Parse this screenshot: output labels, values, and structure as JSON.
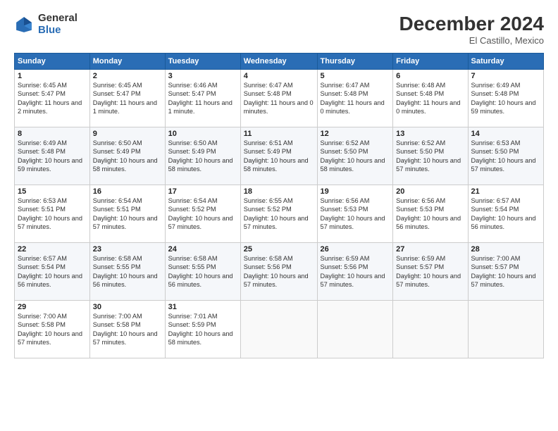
{
  "logo": {
    "general": "General",
    "blue": "Blue"
  },
  "title": "December 2024",
  "location": "El Castillo, Mexico",
  "weekdays": [
    "Sunday",
    "Monday",
    "Tuesday",
    "Wednesday",
    "Thursday",
    "Friday",
    "Saturday"
  ],
  "weeks": [
    [
      {
        "day": "1",
        "sunrise": "6:45 AM",
        "sunset": "5:47 PM",
        "daylight": "11 hours and 2 minutes."
      },
      {
        "day": "2",
        "sunrise": "6:45 AM",
        "sunset": "5:47 PM",
        "daylight": "11 hours and 1 minute."
      },
      {
        "day": "3",
        "sunrise": "6:46 AM",
        "sunset": "5:47 PM",
        "daylight": "11 hours and 1 minute."
      },
      {
        "day": "4",
        "sunrise": "6:47 AM",
        "sunset": "5:48 PM",
        "daylight": "11 hours and 0 minutes."
      },
      {
        "day": "5",
        "sunrise": "6:47 AM",
        "sunset": "5:48 PM",
        "daylight": "11 hours and 0 minutes."
      },
      {
        "day": "6",
        "sunrise": "6:48 AM",
        "sunset": "5:48 PM",
        "daylight": "11 hours and 0 minutes."
      },
      {
        "day": "7",
        "sunrise": "6:49 AM",
        "sunset": "5:48 PM",
        "daylight": "10 hours and 59 minutes."
      }
    ],
    [
      {
        "day": "8",
        "sunrise": "6:49 AM",
        "sunset": "5:48 PM",
        "daylight": "10 hours and 59 minutes."
      },
      {
        "day": "9",
        "sunrise": "6:50 AM",
        "sunset": "5:49 PM",
        "daylight": "10 hours and 58 minutes."
      },
      {
        "day": "10",
        "sunrise": "6:50 AM",
        "sunset": "5:49 PM",
        "daylight": "10 hours and 58 minutes."
      },
      {
        "day": "11",
        "sunrise": "6:51 AM",
        "sunset": "5:49 PM",
        "daylight": "10 hours and 58 minutes."
      },
      {
        "day": "12",
        "sunrise": "6:52 AM",
        "sunset": "5:50 PM",
        "daylight": "10 hours and 58 minutes."
      },
      {
        "day": "13",
        "sunrise": "6:52 AM",
        "sunset": "5:50 PM",
        "daylight": "10 hours and 57 minutes."
      },
      {
        "day": "14",
        "sunrise": "6:53 AM",
        "sunset": "5:50 PM",
        "daylight": "10 hours and 57 minutes."
      }
    ],
    [
      {
        "day": "15",
        "sunrise": "6:53 AM",
        "sunset": "5:51 PM",
        "daylight": "10 hours and 57 minutes."
      },
      {
        "day": "16",
        "sunrise": "6:54 AM",
        "sunset": "5:51 PM",
        "daylight": "10 hours and 57 minutes."
      },
      {
        "day": "17",
        "sunrise": "6:54 AM",
        "sunset": "5:52 PM",
        "daylight": "10 hours and 57 minutes."
      },
      {
        "day": "18",
        "sunrise": "6:55 AM",
        "sunset": "5:52 PM",
        "daylight": "10 hours and 57 minutes."
      },
      {
        "day": "19",
        "sunrise": "6:56 AM",
        "sunset": "5:53 PM",
        "daylight": "10 hours and 57 minutes."
      },
      {
        "day": "20",
        "sunrise": "6:56 AM",
        "sunset": "5:53 PM",
        "daylight": "10 hours and 56 minutes."
      },
      {
        "day": "21",
        "sunrise": "6:57 AM",
        "sunset": "5:54 PM",
        "daylight": "10 hours and 56 minutes."
      }
    ],
    [
      {
        "day": "22",
        "sunrise": "6:57 AM",
        "sunset": "5:54 PM",
        "daylight": "10 hours and 56 minutes."
      },
      {
        "day": "23",
        "sunrise": "6:58 AM",
        "sunset": "5:55 PM",
        "daylight": "10 hours and 56 minutes."
      },
      {
        "day": "24",
        "sunrise": "6:58 AM",
        "sunset": "5:55 PM",
        "daylight": "10 hours and 56 minutes."
      },
      {
        "day": "25",
        "sunrise": "6:58 AM",
        "sunset": "5:56 PM",
        "daylight": "10 hours and 57 minutes."
      },
      {
        "day": "26",
        "sunrise": "6:59 AM",
        "sunset": "5:56 PM",
        "daylight": "10 hours and 57 minutes."
      },
      {
        "day": "27",
        "sunrise": "6:59 AM",
        "sunset": "5:57 PM",
        "daylight": "10 hours and 57 minutes."
      },
      {
        "day": "28",
        "sunrise": "7:00 AM",
        "sunset": "5:57 PM",
        "daylight": "10 hours and 57 minutes."
      }
    ],
    [
      {
        "day": "29",
        "sunrise": "7:00 AM",
        "sunset": "5:58 PM",
        "daylight": "10 hours and 57 minutes."
      },
      {
        "day": "30",
        "sunrise": "7:00 AM",
        "sunset": "5:58 PM",
        "daylight": "10 hours and 57 minutes."
      },
      {
        "day": "31",
        "sunrise": "7:01 AM",
        "sunset": "5:59 PM",
        "daylight": "10 hours and 58 minutes."
      },
      null,
      null,
      null,
      null
    ]
  ]
}
